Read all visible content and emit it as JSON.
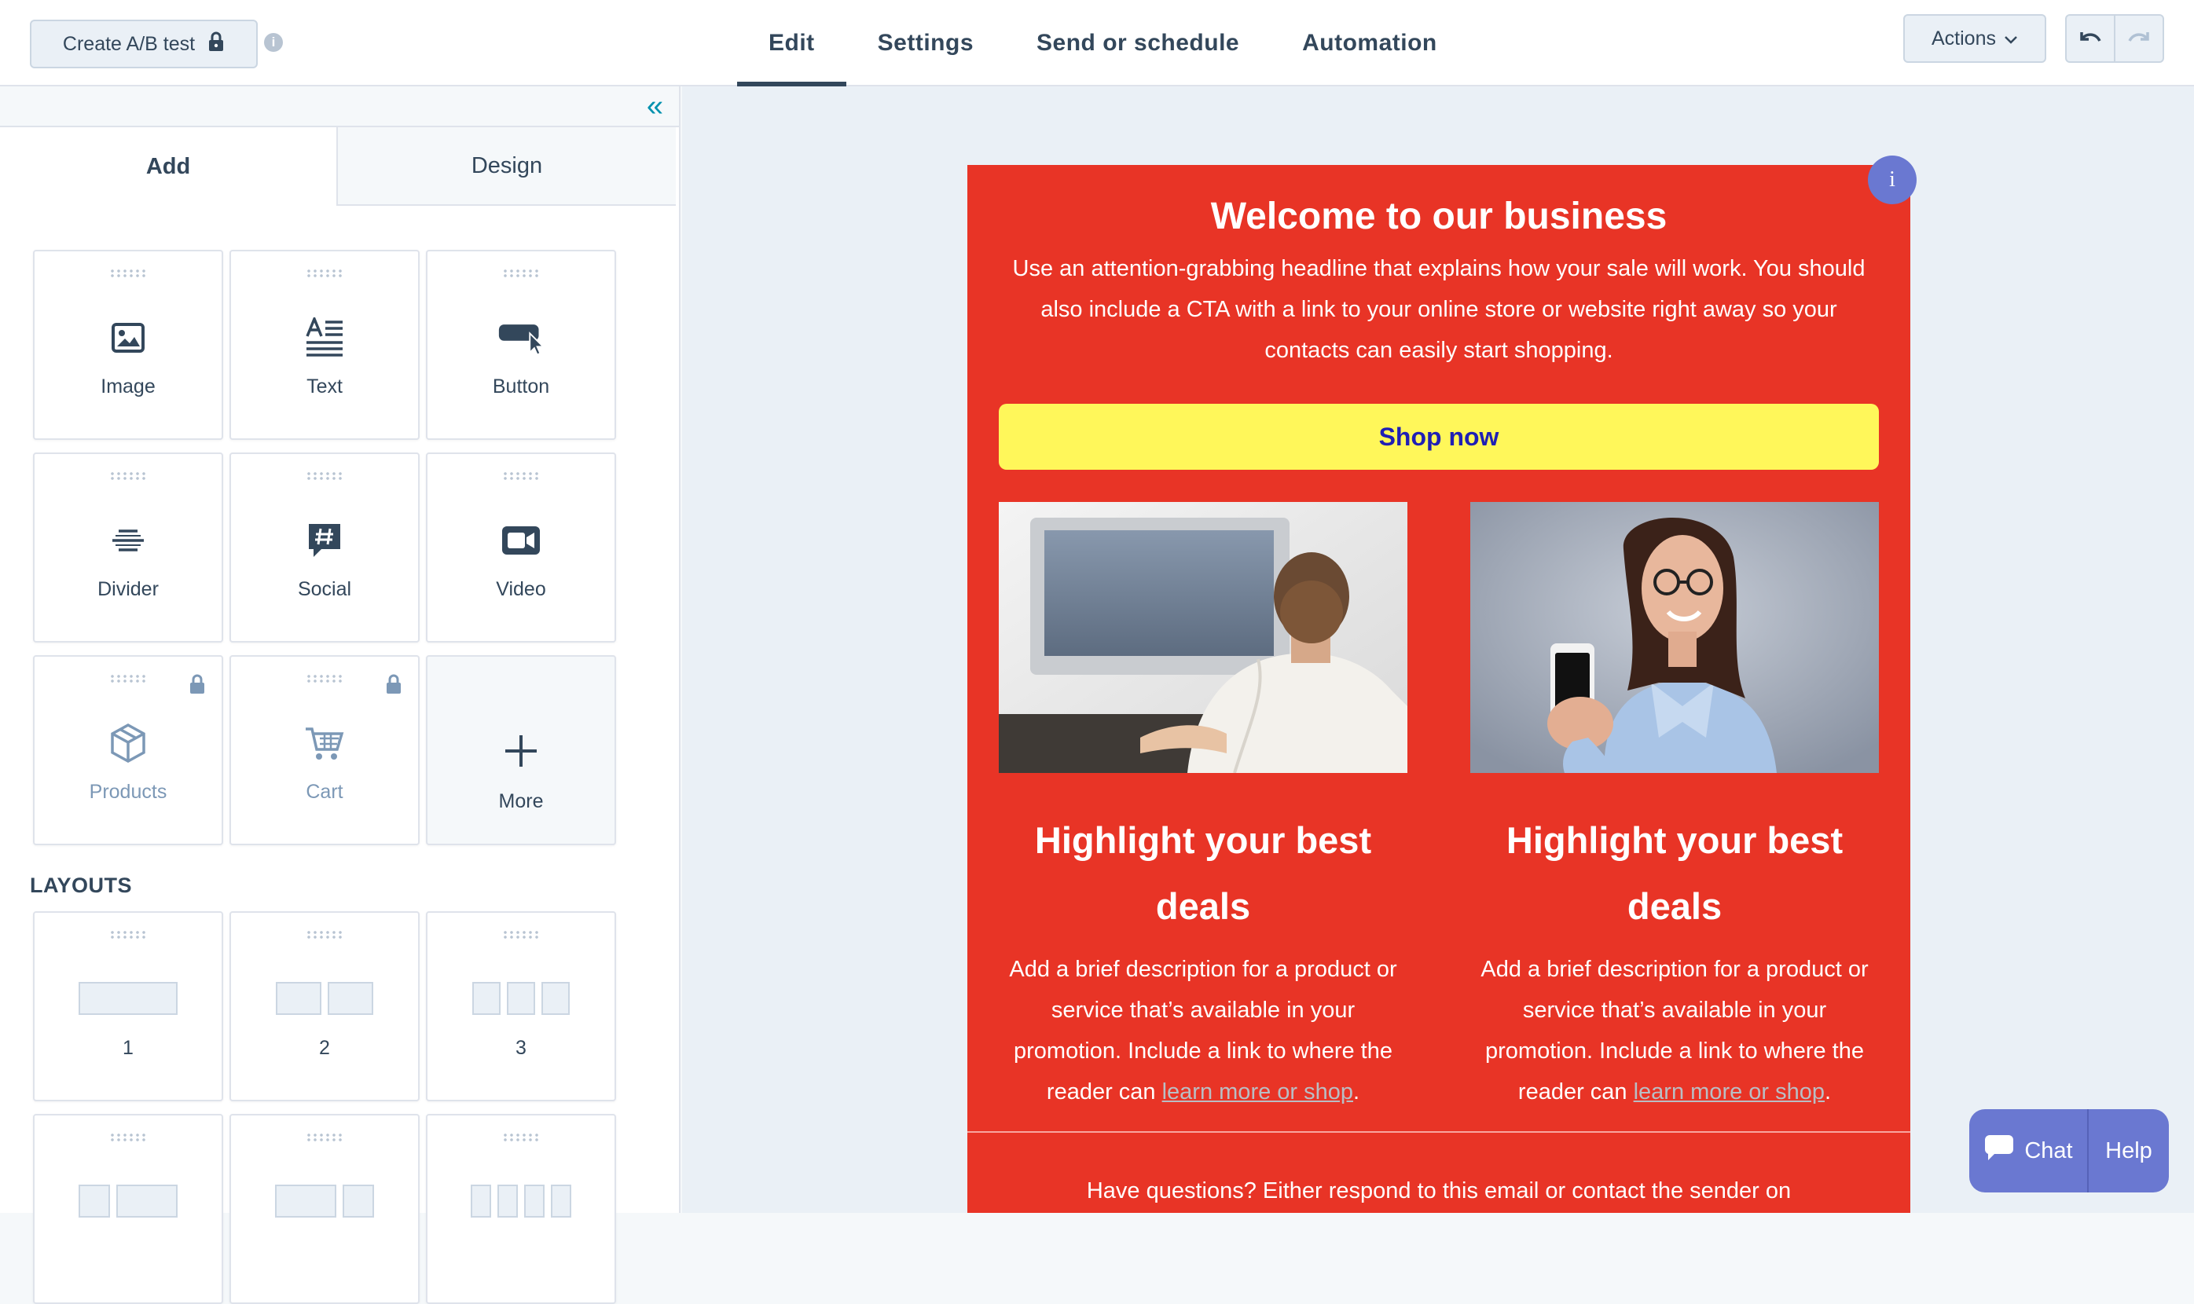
{
  "topbar": {
    "ab_test_label": "Create A/B test",
    "info_glyph": "i",
    "tabs": [
      {
        "label": "Edit",
        "active": true
      },
      {
        "label": "Settings",
        "active": false
      },
      {
        "label": "Send or schedule",
        "active": false
      },
      {
        "label": "Automation",
        "active": false
      }
    ],
    "actions_label": "Actions"
  },
  "sidebar": {
    "collapse_glyph": "«",
    "tabs": [
      {
        "label": "Add",
        "active": true
      },
      {
        "label": "Design",
        "active": false
      }
    ],
    "modules": [
      {
        "label": "Image",
        "icon": "image-icon",
        "locked": false
      },
      {
        "label": "Text",
        "icon": "text-icon",
        "locked": false
      },
      {
        "label": "Button",
        "icon": "button-icon",
        "locked": false
      },
      {
        "label": "Divider",
        "icon": "divider-icon",
        "locked": false
      },
      {
        "label": "Social",
        "icon": "social-icon",
        "locked": false
      },
      {
        "label": "Video",
        "icon": "video-icon",
        "locked": false
      },
      {
        "label": "Products",
        "icon": "products-icon",
        "locked": true
      },
      {
        "label": "Cart",
        "icon": "cart-icon",
        "locked": true
      },
      {
        "label": "More",
        "icon": "plus-icon",
        "locked": false
      }
    ],
    "layouts_title": "LAYOUTS",
    "layouts": [
      {
        "label": "1"
      },
      {
        "label": "2"
      },
      {
        "label": "3"
      }
    ]
  },
  "email": {
    "info_badge": "i",
    "headline": "Welcome to our business",
    "intro": "Use an attention-grabbing headline that explains how your sale will work. You should also include a CTA with a link to your online store or website right away so your contacts can easily start shopping.",
    "cta_label": "Shop now",
    "columns": [
      {
        "heading": "Highlight your best deals",
        "body_prefix": "Add a brief description for a product or service that’s available in your promotion. Include a link to where the reader can ",
        "link_text": "learn more or shop",
        "body_suffix": "."
      },
      {
        "heading": "Highlight your best deals",
        "body_prefix": "Add a brief description for a product or service that’s available in your promotion. Include a link to where the reader can ",
        "link_text": "learn more or shop",
        "body_suffix": "."
      }
    ],
    "footer_text": "Have questions? Either respond to this email or contact the sender on"
  },
  "chat_widget": {
    "chat_label": "Chat",
    "help_label": "Help"
  },
  "colors": {
    "email_background": "#e83426",
    "cta_background": "#fff75a",
    "cta_text": "#1f1fb5",
    "accent": "#6a78d1"
  }
}
